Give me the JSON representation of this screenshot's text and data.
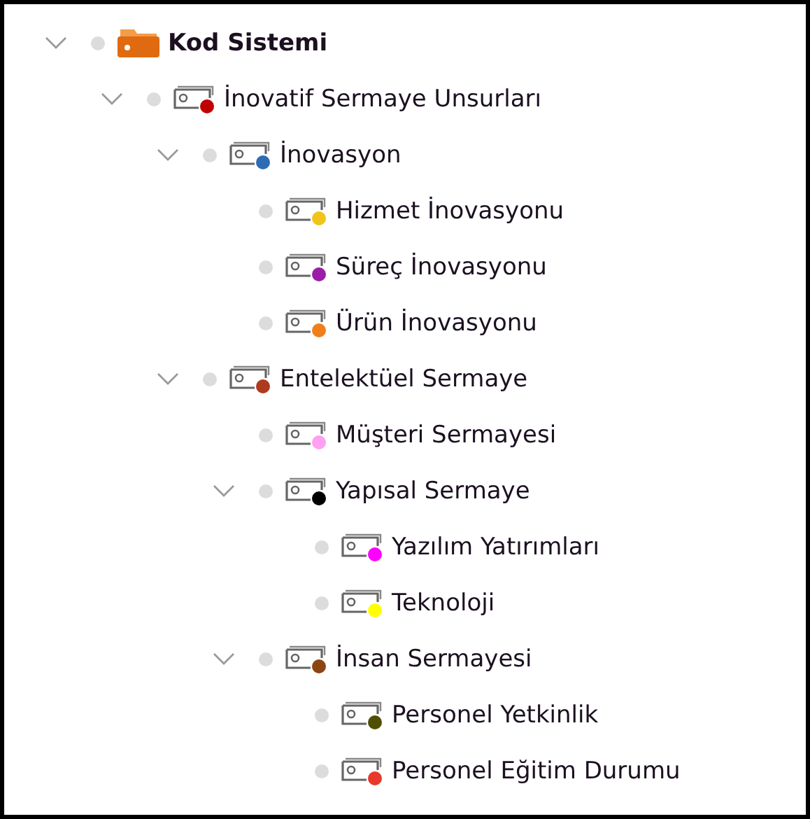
{
  "code_system": {
    "label": "Kod Sistemi",
    "kind": "root",
    "expanded": true,
    "children": [
      {
        "label": "İnovatif Sermaye Unsurları",
        "kind": "code",
        "color": "#c00000",
        "expanded": true,
        "children": [
          {
            "label": "İnovasyon",
            "kind": "code",
            "color": "#2e6db4",
            "expanded": true,
            "children": [
              {
                "label": "Hizmet İnovasyonu",
                "kind": "code",
                "color": "#f0c419"
              },
              {
                "label": "Süreç İnovasyonu",
                "kind": "code",
                "color": "#9b1fa6"
              },
              {
                "label": "Ürün İnovasyonu",
                "kind": "code",
                "color": "#f07f1a"
              }
            ]
          },
          {
            "label": "Entelektüel Sermaye",
            "kind": "code",
            "color": "#b03a1e",
            "expanded": true,
            "children": [
              {
                "label": "Müşteri Sermayesi",
                "kind": "code",
                "color": "#ffa0f0"
              },
              {
                "label": "Yapısal Sermaye",
                "kind": "code",
                "color": "#000000",
                "expanded": true,
                "children": [
                  {
                    "label": "Yazılım Yatırımları",
                    "kind": "code",
                    "color": "#ff00ff"
                  },
                  {
                    "label": "Teknoloji",
                    "kind": "code",
                    "color": "#ffff00"
                  }
                ]
              },
              {
                "label": "İnsan Sermayesi",
                "kind": "code",
                "color": "#8b4513",
                "expanded": true,
                "children": [
                  {
                    "label": "Personel Yetkinlik",
                    "kind": "code",
                    "color": "#4f4f00"
                  },
                  {
                    "label": "Personel Eğitim Durumu",
                    "kind": "code",
                    "color": "#e8392a"
                  }
                ]
              }
            ]
          }
        ]
      }
    ]
  }
}
